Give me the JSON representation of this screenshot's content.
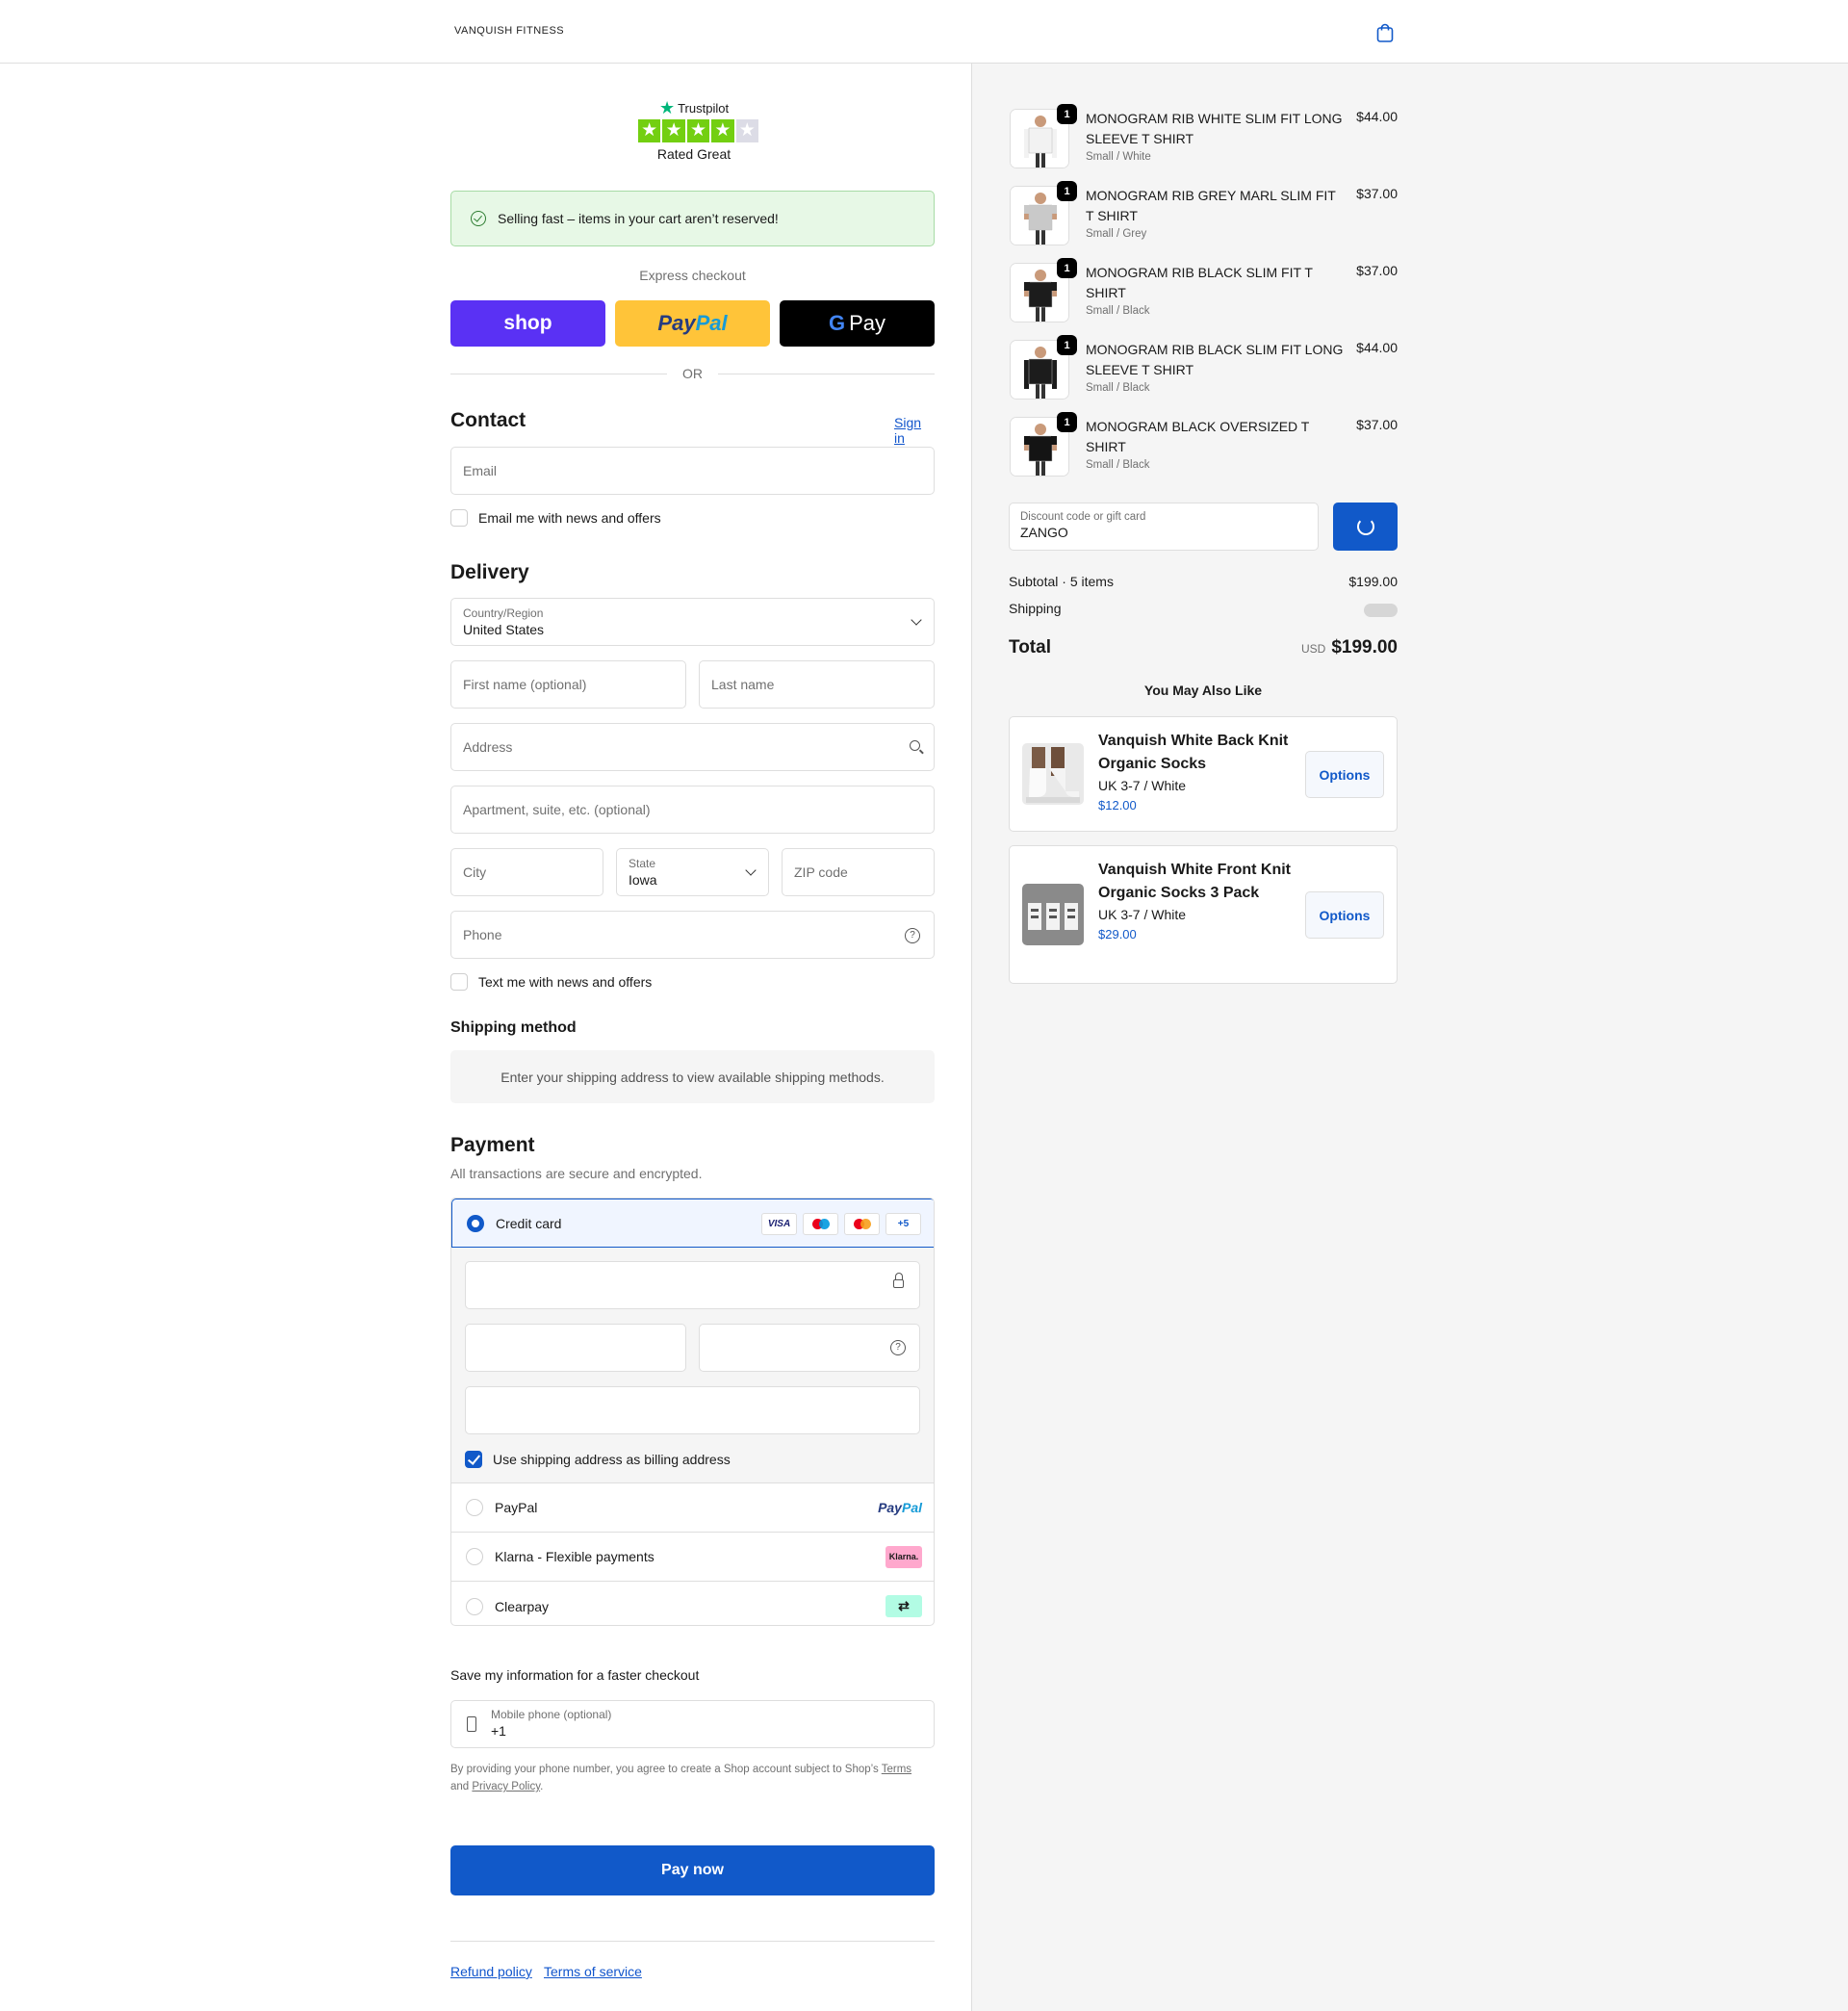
{
  "header": {
    "brand": "VANQUISH FITNESS",
    "cart_icon": "shopping-bag-icon"
  },
  "trustpilot": {
    "brand": "Trustpilot",
    "stars_filled": 4,
    "stars_total": 5,
    "rating_label": "Rated Great"
  },
  "alert": {
    "text": "Selling fast – items in your cart aren’t reserved!"
  },
  "express": {
    "label": "Express checkout",
    "shop": "shop",
    "paypal_a": "Pay",
    "paypal_b": "Pal",
    "gpay_g": "G",
    "gpay_text": "Pay",
    "or": "OR"
  },
  "contact": {
    "heading": "Contact",
    "sign_in": "Sign in",
    "email_placeholder": "Email",
    "news_checkbox": "Email me with news and offers"
  },
  "delivery": {
    "heading": "Delivery",
    "country_label": "Country/Region",
    "country_value": "United States",
    "first_name": "First name (optional)",
    "last_name": "Last name",
    "address": "Address",
    "apartment": "Apartment, suite, etc. (optional)",
    "city": "City",
    "state_label": "State",
    "state_value": "Iowa",
    "zip": "ZIP code",
    "phone": "Phone",
    "text_checkbox": "Text me with news and offers"
  },
  "shipping_method": {
    "heading": "Shipping method",
    "message": "Enter your shipping address to view available shipping methods."
  },
  "payment": {
    "heading": "Payment",
    "subtitle": "All transactions are secure and encrypted.",
    "credit_card": "Credit card",
    "cards": {
      "visa": "VISA",
      "more": "+5"
    },
    "billing_checkbox": "Use shipping address as billing address",
    "options": [
      {
        "label": "PayPal",
        "logo": "PayPal"
      },
      {
        "label": "Klarna - Flexible payments",
        "logo": "Klarna."
      },
      {
        "label": "Clearpay",
        "logo": "⇄"
      }
    ]
  },
  "save_info": {
    "label": "Save my information for a faster checkout",
    "phone_label": "Mobile phone (optional)",
    "phone_value": "+1",
    "disclaimer_prefix": "By providing your phone number, you agree to create a Shop account subject to Shop’s ",
    "terms": "Terms",
    "and": " and ",
    "privacy": "Privacy Policy",
    "period": "."
  },
  "pay_now": "Pay now",
  "footer": {
    "refund": "Refund policy",
    "terms": "Terms of service"
  },
  "cart": {
    "items": [
      {
        "qty": "1",
        "name": "MONOGRAM RIB WHITE SLIM FIT LONG SLEEVE T SHIRT",
        "variant": "Small / White",
        "price": "$44.00",
        "shirt_color": "#f2f2f2"
      },
      {
        "qty": "1",
        "name": "MONOGRAM RIB GREY MARL SLIM FIT T SHIRT",
        "variant": "Small / Grey",
        "price": "$37.00",
        "shirt_color": "#c9c9c9"
      },
      {
        "qty": "1",
        "name": "MONOGRAM RIB BLACK SLIM FIT T SHIRT",
        "variant": "Small / Black",
        "price": "$37.00",
        "shirt_color": "#1c1c1c"
      },
      {
        "qty": "1",
        "name": "MONOGRAM RIB BLACK SLIM FIT LONG SLEEVE T SHIRT",
        "variant": "Small / Black",
        "price": "$44.00",
        "shirt_color": "#1c1c1c"
      },
      {
        "qty": "1",
        "name": "MONOGRAM BLACK OVERSIZED T SHIRT",
        "variant": "Small / Black",
        "price": "$37.00",
        "shirt_color": "#141414"
      }
    ],
    "discount_label": "Discount code or gift card",
    "discount_value": "ZANGO",
    "subtotal_label": "Subtotal · 5 items",
    "subtotal_value": "$199.00",
    "shipping_label": "Shipping",
    "total_label": "Total",
    "currency": "USD",
    "total_value": "$199.00"
  },
  "upsell": {
    "title": "You May Also Like",
    "products": [
      {
        "name": "Vanquish White Back Knit Organic Socks",
        "variant": "UK 3-7 / White",
        "price": "$12.00",
        "button": "Options"
      },
      {
        "name": "Vanquish White Front Knit Organic Socks 3 Pack",
        "variant": "UK 3-7 / White",
        "price": "$29.00",
        "button": "Options"
      }
    ]
  }
}
